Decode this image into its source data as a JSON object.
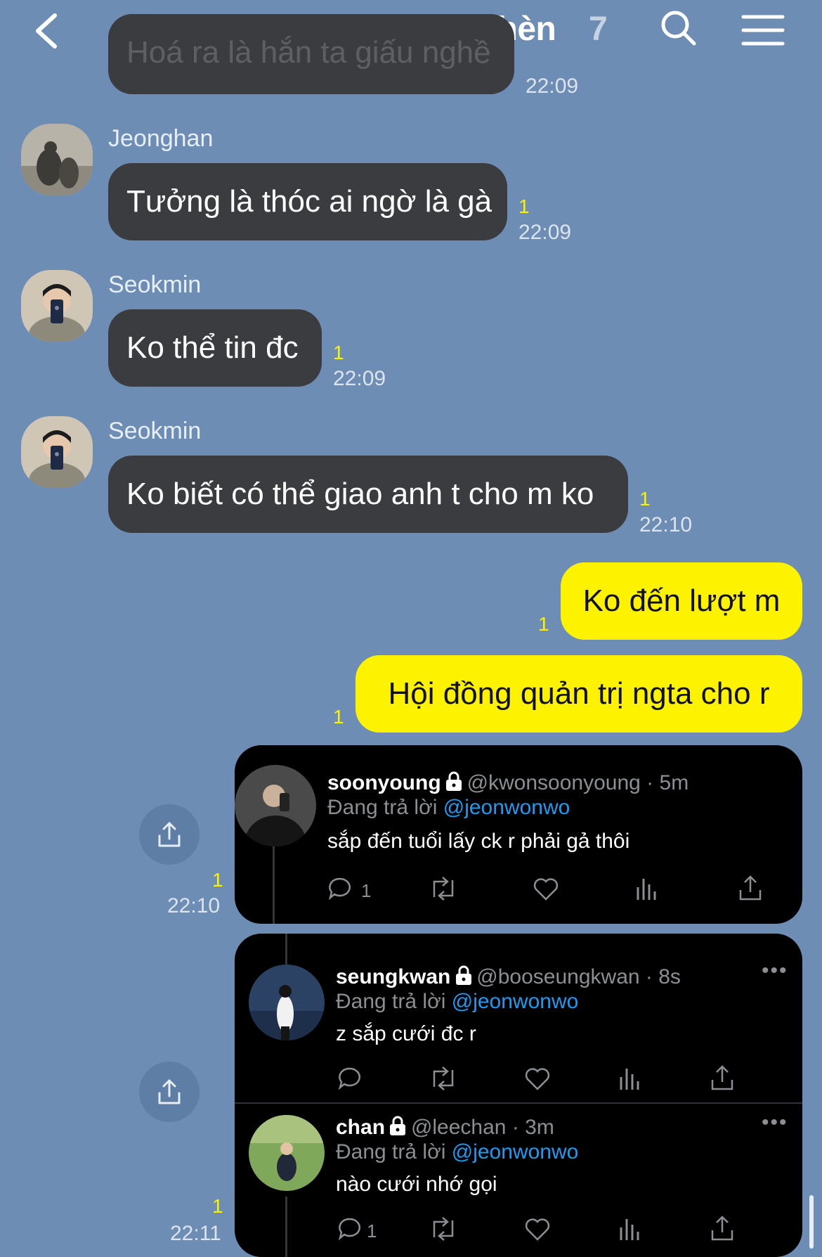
{
  "header": {
    "title": "Bao h mingyu hết hèn",
    "member_count": "7"
  },
  "messages": [
    {
      "text": "Hoá ra là hắn ta giấu nghề",
      "time": "22:09"
    },
    {
      "sender": "Jeonghan",
      "text": "Tưởng là thóc ai ngờ là gà",
      "unread": "1",
      "time": "22:09"
    },
    {
      "sender": "Seokmin",
      "text": "Ko thể tin đc",
      "unread": "1",
      "time": "22:09"
    },
    {
      "sender": "Seokmin",
      "text": "Ko biết có thể giao anh t cho m ko",
      "unread": "1",
      "time": "22:10"
    },
    {
      "text": "Ko đến lượt m",
      "unread": "1"
    },
    {
      "text": "Hội đồng quản trị ngta cho r",
      "unread": "1"
    }
  ],
  "tweet1": {
    "unread": "1",
    "time": "22:10",
    "name": "soonyoung",
    "handle": "@kwonsoonyoung · 5m",
    "reply_prefix": "Đang trả lời",
    "mention": "@jeonwonwo",
    "text": "sắp đến tuổi lấy ck r phải gả thôi",
    "reply_count": "1"
  },
  "tweet2": {
    "unread": "1",
    "time": "22:11",
    "a": {
      "name": "seungkwan",
      "handle": "@booseungkwan · 8s",
      "reply_prefix": "Đang trả lời",
      "mention": "@jeonwonwo",
      "text": "z sắp cưới đc r"
    },
    "b": {
      "name": "chan",
      "handle": "@leechan · 3m",
      "reply_prefix": "Đang trả lời",
      "mention": "@jeonwonwo",
      "text": "nào cưới nhớ gọi",
      "reply_count": "1"
    }
  },
  "colors": {
    "background": "#6e8db5",
    "dark_bubble": "#3b3c40",
    "my_bubble": "#fdf300",
    "unread": "#fdf300",
    "mention": "#1d9bf0"
  }
}
